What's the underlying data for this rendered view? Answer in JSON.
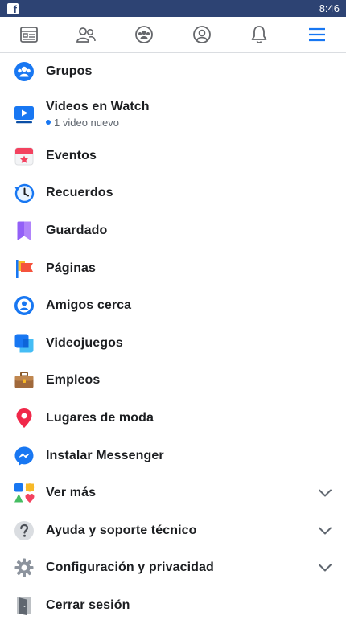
{
  "status_bar": {
    "app_letter": "f",
    "time": "8:46"
  },
  "nav": {
    "tabs": [
      "news-feed",
      "friends",
      "groups",
      "profile",
      "notifications",
      "menu"
    ],
    "active_color": "#1877f2",
    "inactive_color": "#65676b"
  },
  "menu": {
    "items": [
      {
        "label": "Grupos",
        "icon": "groups-icon"
      },
      {
        "label": "Videos en Watch",
        "sub": "1 video nuevo",
        "icon": "watch-icon"
      },
      {
        "label": "Eventos",
        "icon": "events-icon"
      },
      {
        "label": "Recuerdos",
        "icon": "memories-icon"
      },
      {
        "label": "Guardado",
        "icon": "saved-icon"
      },
      {
        "label": "Páginas",
        "icon": "pages-icon"
      },
      {
        "label": "Amigos cerca",
        "icon": "nearby-friends-icon"
      },
      {
        "label": "Videojuegos",
        "icon": "gaming-icon"
      },
      {
        "label": "Empleos",
        "icon": "jobs-icon"
      },
      {
        "label": "Lugares de moda",
        "icon": "places-icon"
      },
      {
        "label": "Instalar Messenger",
        "icon": "messenger-icon"
      },
      {
        "label": "Ver más",
        "icon": "see-more-icon",
        "expandable": true
      },
      {
        "label": "Ayuda y soporte técnico",
        "icon": "help-icon",
        "expandable": true
      },
      {
        "label": "Configuración y privacidad",
        "icon": "settings-icon",
        "expandable": true
      },
      {
        "label": "Cerrar sesión",
        "icon": "logout-icon"
      }
    ]
  }
}
